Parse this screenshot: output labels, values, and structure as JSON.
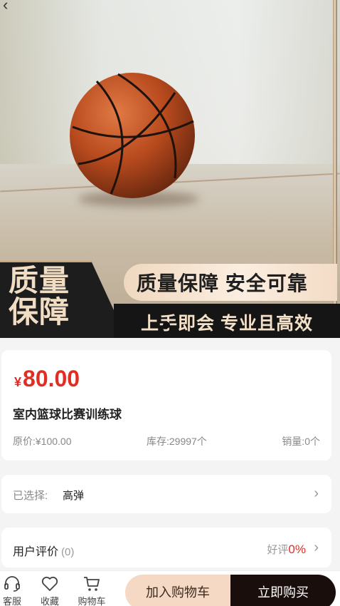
{
  "hero": {
    "back_icon": "chevron-left-icon",
    "badge_text": "质量保障",
    "ribbon_top": "质量保障 安全可靠",
    "ribbon_bottom": "上手即会 专业且高效"
  },
  "product": {
    "currency_symbol": "¥",
    "price": "80.00",
    "title": "室内篮球比赛训练球",
    "original_price": "原价:¥100.00",
    "stock": "库存:29997个",
    "sales": "销量:0个"
  },
  "selection": {
    "label": "已选择:",
    "value": "高弹"
  },
  "reviews": {
    "title": "用户评价",
    "count": "(0)",
    "good_label": "好评",
    "good_rate": "0%"
  },
  "bottom_bar": {
    "service_label": "客服",
    "favorite_label": "收藏",
    "cart_label": "购物车",
    "add_to_cart": "加入购物车",
    "buy_now": "立即购买"
  },
  "colors": {
    "price_red": "#e02e24",
    "cart_button_bg": "#f5d9c4",
    "buy_button_bg": "#1a0e0c"
  }
}
